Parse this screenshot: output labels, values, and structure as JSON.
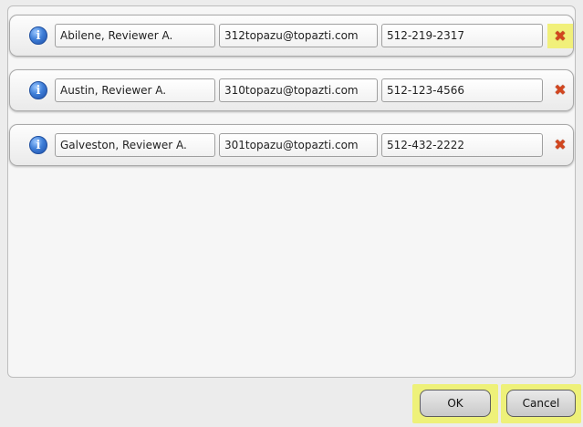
{
  "contacts": [
    {
      "name": "Abilene, Reviewer A.",
      "email": "312topazu@topazti.com",
      "phone": "512-219-2317",
      "info_icon": "info-icon",
      "remove_icon": "remove-x-icon"
    },
    {
      "name": "Austin, Reviewer A.",
      "email": "310topazu@topazti.com",
      "phone": "512-123-4566",
      "info_icon": "info-icon",
      "remove_icon": "remove-x-icon"
    },
    {
      "name": "Galveston, Reviewer A.",
      "email": "301topazu@topazti.com",
      "phone": "512-432-2222",
      "info_icon": "info-icon",
      "remove_icon": "remove-x-icon"
    }
  ],
  "buttons": {
    "ok_label": "OK",
    "cancel_label": "Cancel"
  },
  "colors": {
    "highlight": "#eef179",
    "remove_icon": "#d2461f",
    "info_icon": "#3f7fd8"
  }
}
